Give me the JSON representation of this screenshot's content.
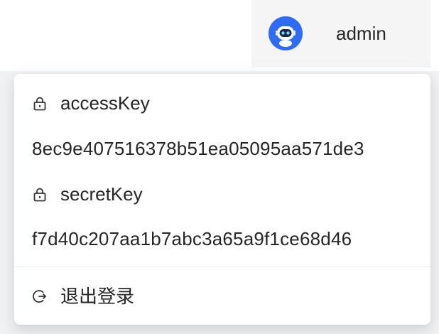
{
  "header": {
    "username": "admin",
    "avatar_icon": "robot-avatar-icon"
  },
  "dropdown": {
    "items": [
      {
        "icon": "lock-icon",
        "label": "accessKey"
      },
      {
        "value": "8ec9e407516378b51ea05095aa571de3"
      },
      {
        "icon": "lock-icon",
        "label": "secretKey"
      },
      {
        "value": "f7d40c207aa1b7abc3a65a9f1ce68d46"
      },
      {
        "icon": "logout-icon",
        "label": "退出登录"
      }
    ]
  },
  "colors": {
    "avatar_bg": "#2f6bf5",
    "text": "#262626"
  }
}
